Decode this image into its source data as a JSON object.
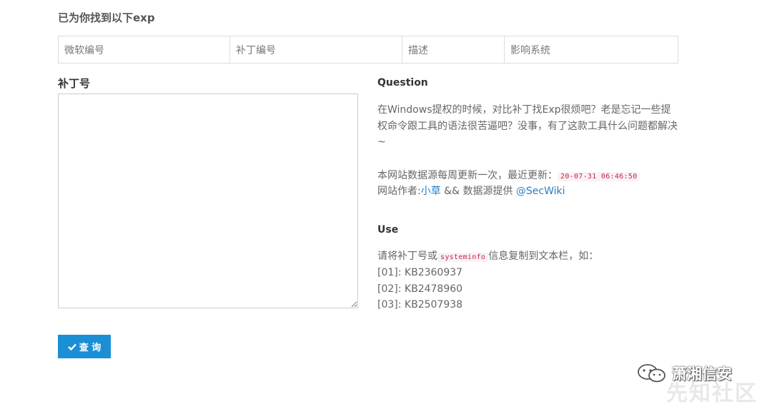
{
  "results": {
    "title": "已为你找到以下exp",
    "columns": [
      "微软编号",
      "补丁编号",
      "描述",
      "影响系统"
    ]
  },
  "form": {
    "patch_label": "补丁号",
    "textarea_value": "",
    "query_label": "查 询"
  },
  "question": {
    "heading": "Question",
    "text": "在Windows提权的时候，对比补丁找Exp很烦吧？老是忘记一些提权命令跟工具的语法很苦逼吧？没事，有了这款工具什么问题都解决~",
    "update_prefix": "本网站数据源每周更新一次，最近更新：",
    "update_time": "20-07-31 06:46:50",
    "author_prefix": "网站作者:",
    "author_name": "小草",
    "source_text": " && 数据源提供 ",
    "source_link": "@SecWiki"
  },
  "use": {
    "heading": "Use",
    "instr_prefix": "请将补丁号或",
    "instr_code": "systeminfo",
    "instr_suffix": "信息复制到文本栏，如：",
    "examples": [
      "[01]: KB2360937",
      "[02]: KB2478960",
      "[03]: KB2507938"
    ]
  },
  "watermark": {
    "brand": "萧湘信安",
    "background_text": "先知社区"
  }
}
